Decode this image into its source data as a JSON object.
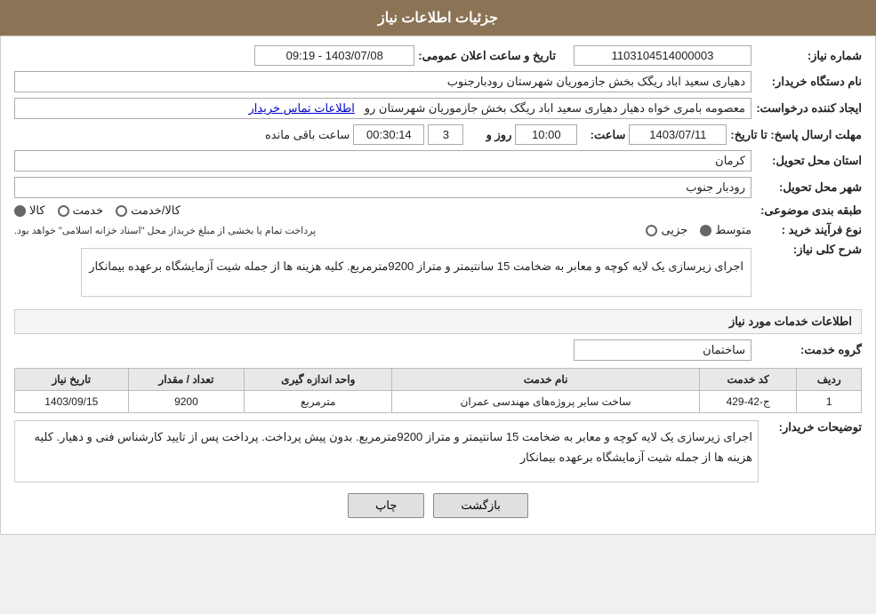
{
  "header": {
    "title": "جزئیات اطلاعات نیاز"
  },
  "fields": {
    "request_number_label": "شماره نیاز:",
    "request_number_value": "1103104514000003",
    "buyer_org_label": "نام دستگاه خریدار:",
    "buyer_org_value": "دهیاری سعید اباد ریگک بخش جازموریان شهرستان رودبارجنوب",
    "creator_label": "ایجاد کننده درخواست:",
    "creator_value": "معصومه بامری خواه دهیار دهیاری سعید اباد ریگک بخش جازموریان شهرستان رو",
    "creator_link": "اطلاعات تماس خریدار",
    "deadline_label": "مهلت ارسال پاسخ: تا تاریخ:",
    "deadline_date": "1403/07/11",
    "deadline_time_label": "ساعت:",
    "deadline_time": "10:00",
    "deadline_days_label": "روز و",
    "deadline_days": "3",
    "deadline_remaining_label": "ساعت باقی مانده",
    "deadline_remaining": "00:30:14",
    "announce_date_label": "تاریخ و ساعت اعلان عمومی:",
    "announce_date_value": "1403/07/08 - 09:19",
    "province_label": "استان محل تحویل:",
    "province_value": "کرمان",
    "city_label": "شهر محل تحویل:",
    "city_value": "رودبار جنوب",
    "category_label": "طبقه بندی موضوعی:",
    "category_options": [
      "کالا",
      "خدمت",
      "کالا/خدمت"
    ],
    "category_selected": "کالا",
    "purchase_type_label": "نوع فرآیند خرید :",
    "purchase_type_options": [
      "جزیی",
      "متوسط"
    ],
    "purchase_type_selected": "متوسط",
    "purchase_type_note": "پرداخت تمام یا بخشی از مبلغ خریداز محل \"اسناد خزانه اسلامی\" خواهد بود.",
    "description_label": "شرح کلی نیاز:",
    "description_text": "اجرای زیرسازی یک لایه کوچه و معابر به ضخامت 15 سانتیمتر و متراز 9200مترمربع. کلیه هزینه ها از جمله شیت آزمایشگاه برعهده بیمانکار",
    "services_section_title": "اطلاعات خدمات مورد نیاز",
    "service_group_label": "گروه خدمت:",
    "service_group_value": "ساختمان",
    "table": {
      "headers": [
        "ردیف",
        "کد خدمت",
        "نام خدمت",
        "واحد اندازه گیری",
        "تعداد / مقدار",
        "تاریخ نیاز"
      ],
      "rows": [
        {
          "row_num": "1",
          "service_code": "ج-42-429",
          "service_name": "ساخت سایر پروژه‌های مهندسی عمران",
          "unit": "مترمربع",
          "quantity": "9200",
          "date_needed": "1403/09/15"
        }
      ]
    },
    "buyer_notes_label": "توضیحات خریدار:",
    "buyer_notes_text": "اجرای زیرسازی یک لایه کوچه و معابر به ضخامت 15 سانتیمتر و متراز 9200مترمربع. بدون پیش پرداخت. پرداخت پس از تایید کارشناس فنی و دهیار. کلیه هزینه ها از جمله شیت آزمایشگاه برعهده بیمانکار",
    "btn_print": "چاپ",
    "btn_back": "بازگشت"
  }
}
